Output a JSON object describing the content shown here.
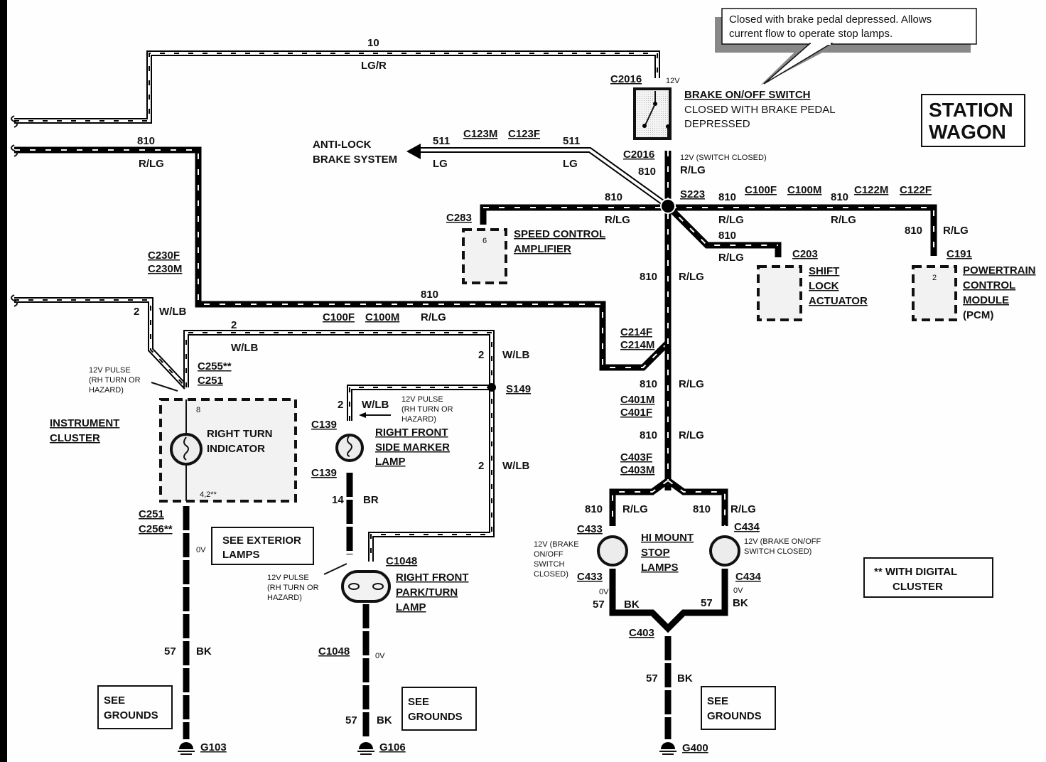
{
  "callout": {
    "line1": "Closed with brake pedal depressed. Allows",
    "line2": "current flow to operate stop lamps."
  },
  "badge": {
    "line1": "STATION",
    "line2": "WAGON"
  },
  "footnote": {
    "line1": "** WITH DIGITAL",
    "line2": "CLUSTER"
  },
  "components": {
    "brake_switch": {
      "name": "BRAKE ON/OFF SWITCH",
      "desc1": "CLOSED WITH BRAKE PEDAL",
      "desc2": "DEPRESSED"
    },
    "abs": {
      "line1": "ANTI-LOCK",
      "line2": "BRAKE SYSTEM"
    },
    "speed_control": {
      "line1": "SPEED CONTROL",
      "line2": "AMPLIFIER",
      "pin": "6"
    },
    "shift_lock": {
      "line1": "SHIFT",
      "line2": "LOCK",
      "line3": "ACTUATOR"
    },
    "pcm": {
      "line1": "POWERTRAIN",
      "line2": "CONTROL",
      "line3": "MODULE",
      "line4": "(PCM)",
      "pin": "2"
    },
    "instrument_cluster": {
      "line1": "INSTRUMENT",
      "line2": "CLUSTER"
    },
    "right_turn_indicator": {
      "line1": "RIGHT TURN",
      "line2": "INDICATOR",
      "pin_top": "8",
      "pin_bottom": "4,2**"
    },
    "side_marker": {
      "line1": "RIGHT FRONT",
      "line2": "SIDE MARKER",
      "line3": "LAMP"
    },
    "park_turn": {
      "line1": "RIGHT FRONT",
      "line2": "PARK/TURN",
      "line3": "LAMP"
    },
    "hi_mount": {
      "line1": "HI MOUNT",
      "line2": "STOP",
      "line3": "LAMPS"
    }
  },
  "see_boxes": {
    "exterior": {
      "line1": "SEE EXTERIOR",
      "line2": "LAMPS"
    },
    "grounds1": {
      "line1": "SEE",
      "line2": "GROUNDS"
    },
    "grounds2": {
      "line1": "SEE",
      "line2": "GROUNDS"
    },
    "grounds3": {
      "line1": "SEE",
      "line2": "GROUNDS"
    }
  },
  "connectors": {
    "c2016_top": "C2016",
    "c2016_bot": "C2016",
    "c123m": "C123M",
    "c123f": "C123F",
    "s223": "S223",
    "c100f_a": "C100F",
    "c100m_a": "C100M",
    "c122m": "C122M",
    "c122f": "C122F",
    "c283": "C283",
    "c203": "C203",
    "c191": "C191",
    "c230f": "C230F",
    "c230m": "C230M",
    "c100f_b": "C100F",
    "c100m_b": "C100M",
    "c255": "C255**",
    "c251_top": "C251",
    "c214f": "C214F",
    "c214m": "C214M",
    "s149": "S149",
    "c139_top": "C139",
    "c139_bot": "C139",
    "c401m": "C401M",
    "c401f": "C401F",
    "c403f": "C403F",
    "c403m": "C403M",
    "c251_bot": "C251",
    "c256": "C256**",
    "c1048_top": "C1048",
    "c1048_bot": "C1048",
    "c433_top": "C433",
    "c433_bot": "C433",
    "c434_top": "C434",
    "c434_bot": "C434",
    "c403": "C403",
    "g103": "G103",
    "g106": "G106",
    "g400": "G400"
  },
  "wires": {
    "w10_num": "10",
    "w10_color": "LG/R",
    "w810_left_num": "810",
    "w810_left_color": "R/LG",
    "w511_left_num": "511",
    "w511_left_color": "LG",
    "w511_right_num": "511",
    "w511_right_color": "LG",
    "w810_sw_num": "810",
    "w810_sw_color": "R/LG",
    "w810_scA_num": "810",
    "w810_scA_color": "R/LG",
    "w810_e1_num": "810",
    "w810_e1_color": "R/LG",
    "w810_e2_num": "810",
    "w810_e2_color": "R/LG",
    "w810_pcm_num": "810",
    "w810_pcm_color": "R/LG",
    "w810_sla_num": "810",
    "w810_sla_color": "R/LG",
    "w810_v1_num": "810",
    "w810_v1_color": "R/LG",
    "w810_mid_num": "810",
    "w810_mid_color": "R/LG",
    "w2_left_num": "2",
    "w2_left_color": "W/LB",
    "w2_top_num": "2",
    "w2_top_color": "W/LB",
    "w2_r1_num": "2",
    "w2_r1_color": "W/LB",
    "w2_r2_num": "2",
    "w2_r2_color": "W/LB",
    "w2_sm_num": "2",
    "w2_sm_color": "W/LB",
    "w810_v2_num": "810",
    "w810_v2_color": "R/LG",
    "w810_v3_num": "810",
    "w810_v3_color": "R/LG",
    "w810_hl_num": "810",
    "w810_hl_color": "R/LG",
    "w810_hr_num": "810",
    "w810_hr_color": "R/LG",
    "w14_num": "14",
    "w14_color": "BR",
    "w57_a_num": "57",
    "w57_a_color": "BK",
    "w57_b_num": "57",
    "w57_b_color": "BK",
    "w57_hl_num": "57",
    "w57_hl_color": "BK",
    "w57_hr_num": "57",
    "w57_hr_color": "BK",
    "w57_c_num": "57",
    "w57_c_color": "BK"
  },
  "voltages": {
    "v_12v_top": "12V",
    "v_switch_closed": "12V (SWITCH CLOSED)",
    "pulse_ic_1": "12V PULSE",
    "pulse_ic_2": "(RH TURN OR",
    "pulse_ic_3": "HAZARD)",
    "pulse_sm_1": "12V PULSE",
    "pulse_sm_2": "(RH TURN OR",
    "pulse_sm_3": "HAZARD)",
    "pulse_pt_1": "12V PULSE",
    "pulse_pt_2": "(RH TURN OR",
    "pulse_pt_3": "HAZARD)",
    "v0_ic": "0V",
    "v0_pt": "0V",
    "v0_hl": "0V",
    "v0_hr": "0V",
    "hl_1": "12V (BRAKE",
    "hl_2": "ON/OFF",
    "hl_3": "SWITCH",
    "hl_4": "CLOSED)",
    "hr_1": "12V (BRAKE ON/OFF",
    "hr_2": "SWITCH  CLOSED)"
  }
}
